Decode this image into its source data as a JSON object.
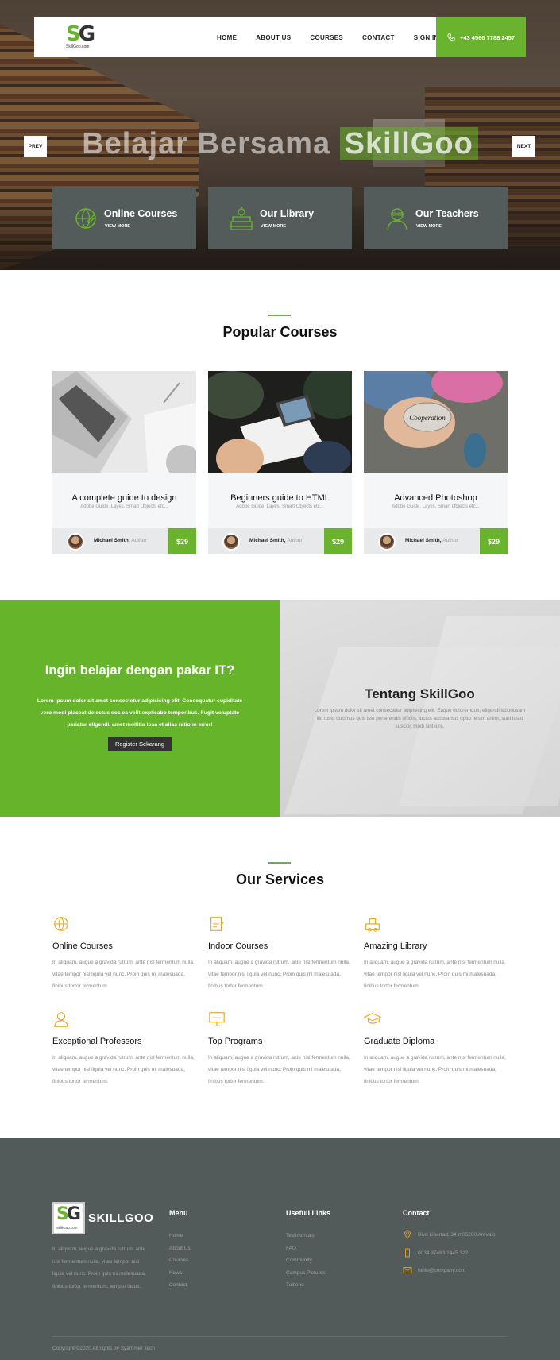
{
  "header": {
    "logo": {
      "monogram_s": "S",
      "monogram_g": "G",
      "name": "SkillGoo.com"
    },
    "nav": [
      "HOME",
      "ABOUT US",
      "COURSES",
      "CONTACT",
      "SIGN IN"
    ],
    "phone": "+43 4566 7788 2457"
  },
  "hero": {
    "title_start": "Belajar Bersama ",
    "title_highlight": "SkillGoo",
    "prev_label": "PREV",
    "next_label": "NEXT",
    "features": [
      {
        "title": "Online Courses",
        "link": "VIEW MORE",
        "icon": "globe-pencil-icon"
      },
      {
        "title": "Our Library",
        "link": "VIEW MORE",
        "icon": "books-icon"
      },
      {
        "title": "Our Teachers",
        "link": "VIEW MORE",
        "icon": "teacher-icon"
      }
    ]
  },
  "popular": {
    "title": "Popular Courses",
    "courses": [
      {
        "title": "A complete guide to design",
        "subtitle": "Adobe Guide, Layes, Smart Objects etc...",
        "author": "Michael Smith,",
        "author_role": "Author",
        "price": "$29"
      },
      {
        "title": "Beginners guide to HTML",
        "subtitle": "Adobe Guide, Layes, Smart Objects etc...",
        "author": "Michael Smith,",
        "author_role": "Author",
        "price": "$29"
      },
      {
        "title": "Advanced Photoshop",
        "subtitle": "Adobe Guide, Layes, Smart Objects etc...",
        "author": "Michael Smith,",
        "author_role": "Author",
        "price": "$29"
      }
    ],
    "stone_text": "Cooperation"
  },
  "cta": {
    "title": "Ingin belajar dengan pakar IT?",
    "text": "Lorem ipsum dolor sit amet consectetur adipisicing elit. Consequatur cupiditate vero modi placeat delectus eos ea velit explicabo temporibus. Fugit voluptate pariatur eligendi, amet mollitia ipsa et alias ratione error!",
    "button": "Register Sekarang"
  },
  "about": {
    "title": "Tentang SkillGoo",
    "text": "Lorem ipsum dolor sit amet consectetur adipisicing elit. Eaque doloremque, eligendi laboriosam illo iusto ducimus quis iste perferendis officiis, luctus accusamus optio rerum animi, sunt iusto suscipit modi sint iure."
  },
  "services": {
    "title": "Our Services",
    "items": [
      {
        "title": "Online Courses",
        "text": "In aliquam, augue a gravida rutrum, ante nisl fermentum nulla, vitae tempor nisl ligula vel nunc. Proin quis mi malesuada, finibus tortor fermentum.",
        "icon": "globe-icon"
      },
      {
        "title": "Indoor Courses",
        "text": "In aliquam, augue a gravida rutrum, ante nisl fermentum nulla, vitae tempor nisl ligula vel nunc. Proin quis mi malesuada, finibus tortor fermentum.",
        "icon": "document-icon"
      },
      {
        "title": "Amazing Library",
        "text": "In aliquam, augue a gravida rutrum, ante nisl fermentum nulla, vitae tempor nisl ligula vel nunc. Proin quis mi malesuada, finibus tortor fermentum.",
        "icon": "library-icon"
      },
      {
        "title": "Exceptional Professors",
        "text": "In aliquam, augue a gravida rutrum, ante nisl fermentum nulla, vitae tempor nisl ligula vel nunc. Proin quis mi malesuada, finibus tortor fermentum.",
        "icon": "professor-icon"
      },
      {
        "title": "Top Programs",
        "text": "In aliquam, augue a gravida rutrum, ante nisl fermentum nulla, vitae tempor nisl ligula vel nunc. Proin quis mi malesuada, finibus tortor fermentum.",
        "icon": "presentation-icon"
      },
      {
        "title": "Graduate Diploma",
        "text": "In aliquam, augue a gravida rutrum, ante nisl fermentum nulla, vitae tempor nisl ligula vel nunc. Proin quis mi malesuada, finibus tortor fermentum.",
        "icon": "graduation-cap-icon"
      }
    ]
  },
  "footer": {
    "brand": "SKILLGOO",
    "about": "In aliquam, augue a gravida rutrum, ante nisl fermentum nulla, vitae tempor nisl ligula vel nunc. Proin quis mi malesuada, finibus tortor fermentum, tempor lacus.",
    "menu_title": "Menu",
    "menu": [
      "Home",
      "About Us",
      "Courses",
      "News",
      "Contact"
    ],
    "links_title": "Usefull Links",
    "links": [
      "Testimonials",
      "FAQ",
      "Community",
      "Campus Pictures",
      "Tuitions"
    ],
    "contact_title": "Contact",
    "address": "Blvd Libertad, 34 m05200 Arévalo",
    "phone": "0034 37483 2445 322",
    "email": "hello@company.com",
    "copyright": "Copyright ©2020 All rights by Syammer Tech"
  },
  "colors": {
    "accent": "#6ab32e",
    "dark": "#535a5a",
    "icon_gold": "#e8a317"
  }
}
